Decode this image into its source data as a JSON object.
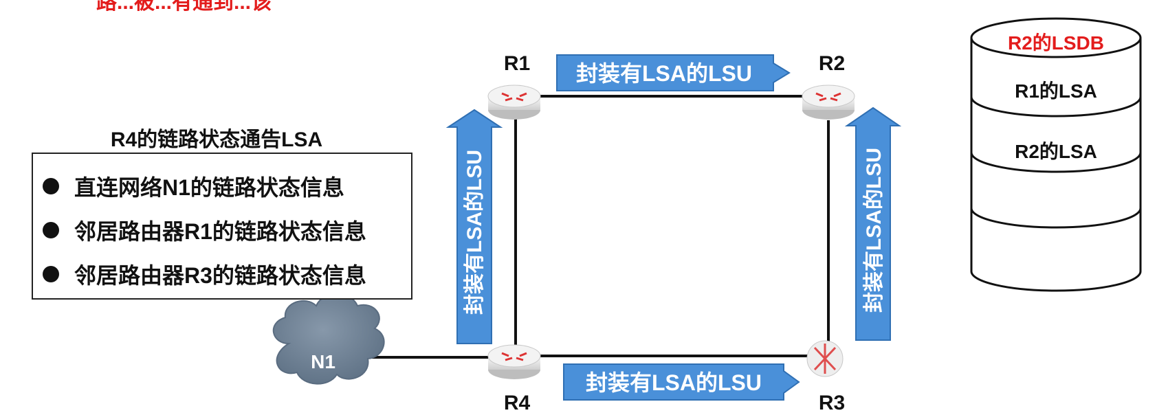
{
  "header_fragment": "路...被...有通到...该",
  "routers": {
    "r1": "R1",
    "r2": "R2",
    "r3": "R3",
    "r4": "R4"
  },
  "network": {
    "n1": "N1"
  },
  "arrows": {
    "top": "封装有LSA的LSU",
    "left": "封装有LSA的LSU",
    "right": "封装有LSA的LSU",
    "bottom": "封装有LSA的LSU"
  },
  "lsa_panel": {
    "title": "R4的链路状态通告LSA",
    "items": [
      "直连网络N1的链路状态信息",
      "邻居路由器R1的链路状态信息",
      "邻居路由器R3的链路状态信息"
    ]
  },
  "lsdb": {
    "title": "R2的LSDB",
    "entries": [
      "R1的LSA",
      "R2的LSA",
      "",
      ""
    ]
  },
  "colors": {
    "arrow_fill": "#4a90d9",
    "arrow_stroke": "#2f6fb3",
    "lsdb_title": "#e31c1c",
    "cloud": "#6b7f94",
    "router_body": "#e6e6e6"
  }
}
